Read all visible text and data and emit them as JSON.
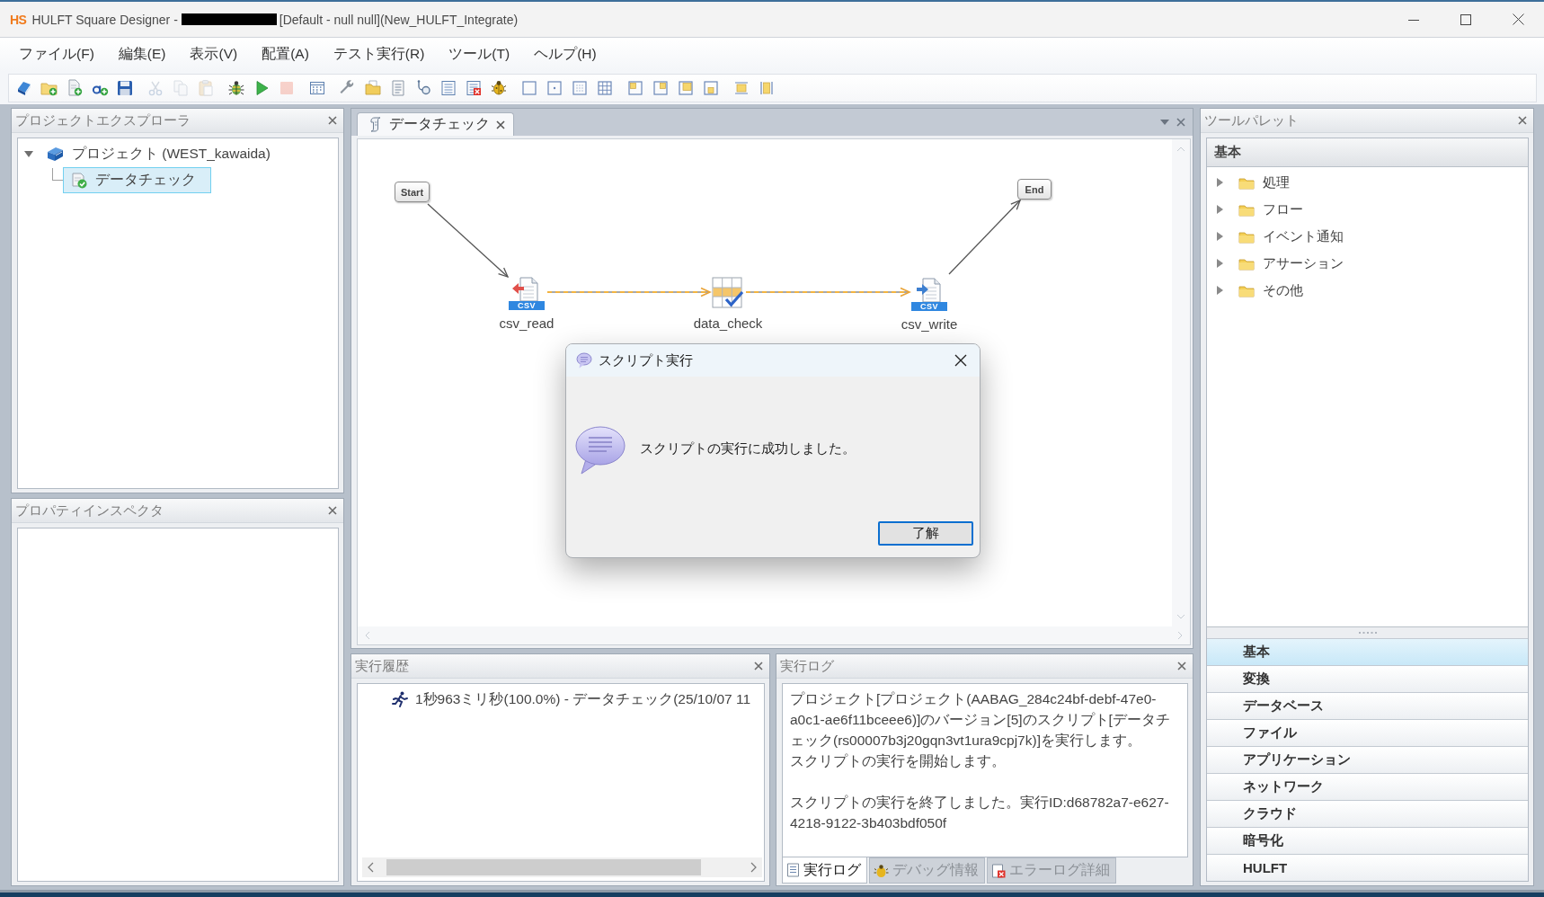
{
  "window": {
    "logo": "HS",
    "title_start": "HULFT Square Designer -",
    "title_end": "[Default - null null](New_HULFT_Integrate)"
  },
  "menu": [
    "ファイル(F)",
    "編集(E)",
    "表示(V)",
    "配置(A)",
    "テスト実行(R)",
    "ツール(T)",
    "ヘルプ(H)"
  ],
  "toolbar": [
    [
      {
        "kind": "edit",
        "disabled": false
      },
      {
        "kind": "newfolder",
        "disabled": false
      },
      {
        "kind": "newfile",
        "disabled": false
      },
      {
        "kind": "addtext",
        "disabled": false
      },
      {
        "kind": "save",
        "disabled": false
      }
    ],
    [
      {
        "kind": "cut",
        "disabled": true
      },
      {
        "kind": "copy",
        "disabled": true
      },
      {
        "kind": "paste",
        "disabled": true
      }
    ],
    [
      {
        "kind": "build",
        "disabled": false
      },
      {
        "kind": "run",
        "disabled": false
      },
      {
        "kind": "stop",
        "disabled": true
      }
    ],
    [
      {
        "kind": "grid",
        "disabled": false
      }
    ],
    [
      {
        "kind": "wrench",
        "disabled": false
      },
      {
        "kind": "folder",
        "disabled": false
      },
      {
        "kind": "document",
        "disabled": false
      },
      {
        "kind": "inspect",
        "disabled": false
      },
      {
        "kind": "list",
        "disabled": false
      },
      {
        "kind": "deletelist",
        "disabled": false
      },
      {
        "kind": "bug",
        "disabled": false
      }
    ],
    [
      {
        "kind": "frame",
        "disabled": false
      },
      {
        "kind": "framedot",
        "disabled": false
      },
      {
        "kind": "framedots",
        "disabled": false
      },
      {
        "kind": "framegrid",
        "disabled": false
      }
    ],
    [
      {
        "kind": "alignleft",
        "disabled": false
      },
      {
        "kind": "alignright",
        "disabled": false
      },
      {
        "kind": "aligntop",
        "disabled": false
      },
      {
        "kind": "alignbottom",
        "disabled": false
      }
    ],
    [
      {
        "kind": "fitwidth",
        "disabled": false
      },
      {
        "kind": "fitheight",
        "disabled": false
      }
    ]
  ],
  "project_explorer": {
    "title": "プロジェクトエクスプローラ",
    "tree": [
      {
        "label": "プロジェクト (WEST_kawaida)",
        "expanded": true,
        "selected": false,
        "children": [
          {
            "label": "データチェック",
            "selected": true
          }
        ]
      }
    ]
  },
  "property_inspector": {
    "title": "プロパティインスペクタ"
  },
  "editor": {
    "tabs": [
      {
        "label": "データチェック",
        "selected": true
      }
    ],
    "nodes": [
      {
        "kind": "terminal",
        "label": "Start"
      },
      {
        "kind": "csvread",
        "label": "csv_read",
        "badge": "CSV"
      },
      {
        "kind": "check",
        "label": "data_check"
      },
      {
        "kind": "csvwrite",
        "label": "csv_write",
        "badge": "CSV"
      },
      {
        "kind": "terminal",
        "label": "End"
      }
    ],
    "connectors": [
      {
        "kind": "control"
      },
      {
        "kind": "data"
      },
      {
        "kind": "data"
      },
      {
        "kind": "control"
      }
    ]
  },
  "dialog": {
    "title": "スクリプト実行",
    "message": "スクリプトの実行に成功しました。",
    "button": "了解"
  },
  "history": {
    "title": "実行履歴",
    "rows": [
      {
        "text": "1秒963ミリ秒(100.0%) - データチェック(25/10/07 11"
      }
    ]
  },
  "log": {
    "title": "実行ログ",
    "paragraphs": [
      [
        "プロジェクト[プロジェクト(AABAG_284c24bf-debf-47e0-a0c1-ae6f11bceee6)]のバージョン[5]のスクリプト[データチェック(rs00007b3j20gqn3vt1ura9cpj7k)]を実行します。",
        "スクリプトの実行を開始します。"
      ],
      [
        "スクリプトの実行を終了しました。実行ID:d68782a7-e627-4218-9122-3b403bdf050f"
      ]
    ],
    "tabs": [
      {
        "kind": "log",
        "label": "実行ログ",
        "selected": true
      },
      {
        "kind": "debug",
        "label": "デバッグ情報",
        "selected": false
      },
      {
        "kind": "error",
        "label": "エラーログ詳細",
        "selected": false
      }
    ]
  },
  "palette": {
    "title": "ツールパレット",
    "section": "基本",
    "tree": [
      {
        "label": "処理",
        "expanded": false
      },
      {
        "label": "フロー",
        "expanded": false
      },
      {
        "label": "イベント通知",
        "expanded": false
      },
      {
        "label": "アサーション",
        "expanded": false
      },
      {
        "label": "その他",
        "expanded": false
      }
    ],
    "categories": [
      {
        "label": "基本",
        "selected": true
      },
      {
        "label": "変換",
        "selected": false
      },
      {
        "label": "データベース",
        "selected": false
      },
      {
        "label": "ファイル",
        "selected": false
      },
      {
        "label": "アプリケーション",
        "selected": false
      },
      {
        "label": "ネットワーク",
        "selected": false
      },
      {
        "label": "クラウド",
        "selected": false
      },
      {
        "label": "暗号化",
        "selected": false
      },
      {
        "label": "HULFT",
        "selected": false
      }
    ]
  }
}
